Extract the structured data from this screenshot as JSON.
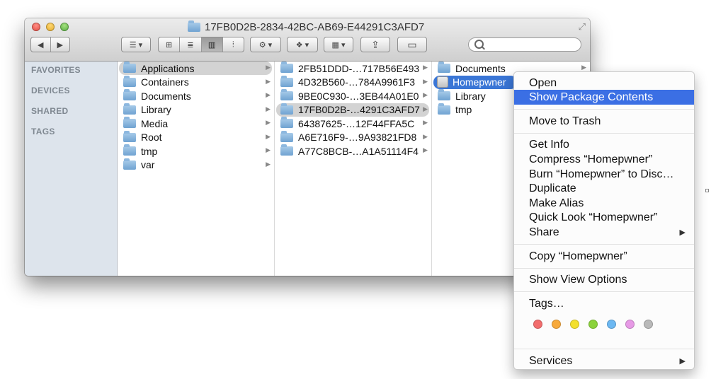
{
  "window": {
    "title": "17FB0D2B-2834-42BC-AB69-E44291C3AFD7",
    "fullscreen_icon": "⤢"
  },
  "toolbar": {
    "back_icon": "◀",
    "forward_icon": "▶",
    "arrange_icon": "☰ ▾",
    "view_icons": [
      "⊞",
      "≣",
      "▥",
      "⦙"
    ],
    "action_icon": "⚙ ▾",
    "dropbox_icon": "❖ ▾",
    "group_icon": "▦ ▾",
    "share_icon": "⇪",
    "tag_icon": "▭"
  },
  "sidebar": {
    "sections": [
      "FAVORITES",
      "DEVICES",
      "SHARED",
      "TAGS"
    ]
  },
  "columns": [
    {
      "items": [
        "Applications",
        "Containers",
        "Documents",
        "Library",
        "Media",
        "Root",
        "tmp",
        "var"
      ],
      "selected": 0
    },
    {
      "items": [
        "2FB51DDD-…717B56E493",
        "4D32B560-…784A9961F3",
        "9BE0C930-…3EB44A01E0",
        "17FB0D2B-…4291C3AFD7",
        "64387625-…12F44FFA5C",
        "A6E716F9-…9A93821FD8",
        "A77C8BCB-…A1A51114F4"
      ],
      "selected": 3
    },
    {
      "items": [
        "Documents",
        "Homepwner",
        "Library",
        "tmp"
      ],
      "selected": 1
    }
  ],
  "context_menu": {
    "open": "Open",
    "show_package_contents": "Show Package Contents",
    "move_to_trash": "Move to Trash",
    "get_info": "Get Info",
    "compress": "Compress “Homepwner”",
    "burn": "Burn “Homepwner” to Disc…",
    "duplicate": "Duplicate",
    "make_alias": "Make Alias",
    "quick_look": "Quick Look “Homepwner”",
    "share": "Share",
    "copy": "Copy “Homepwner”",
    "show_view_options": "Show View Options",
    "tags": "Tags…",
    "services": "Services",
    "submenu_arrow": "▶",
    "tag_colors": [
      "#f26d6d",
      "#f7a93b",
      "#f3e02c",
      "#8ad23a",
      "#6cb8f2",
      "#e79ae6",
      "#b9b9b9"
    ]
  }
}
